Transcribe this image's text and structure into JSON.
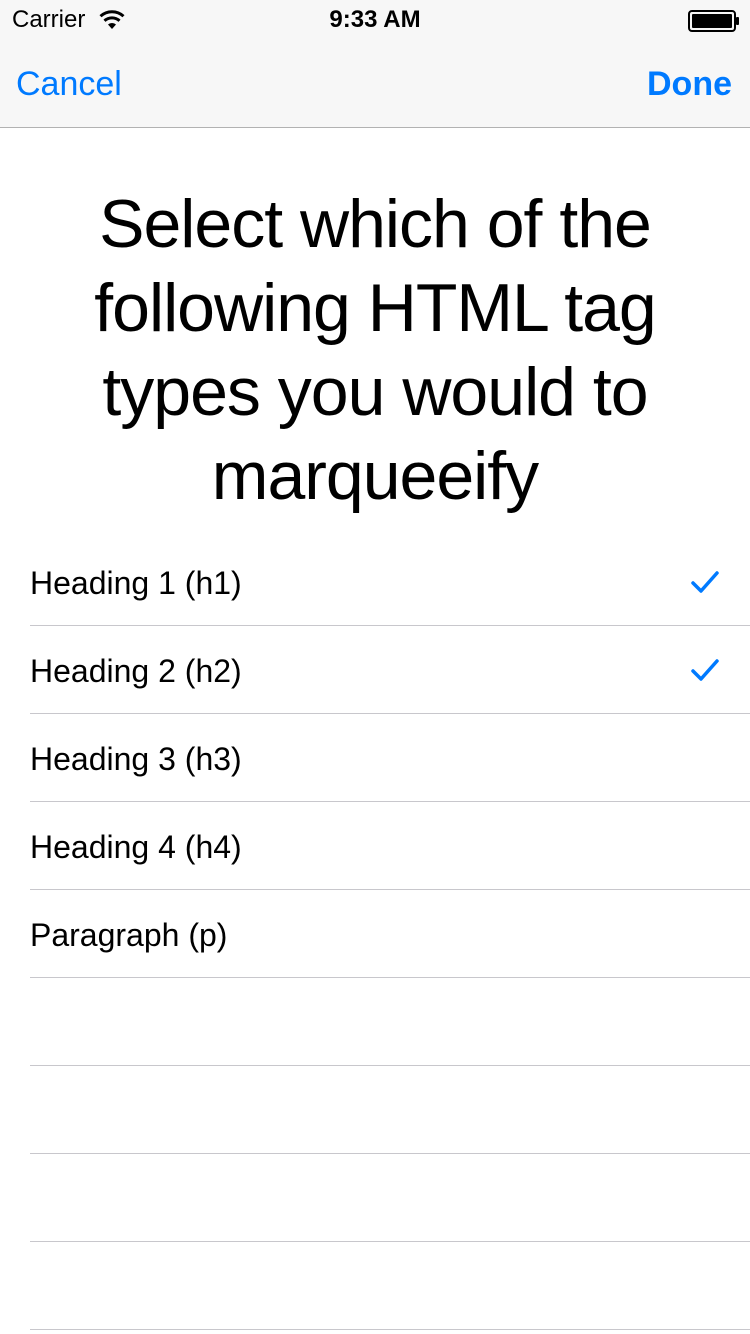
{
  "status_bar": {
    "carrier": "Carrier",
    "time": "9:33 AM",
    "icons": [
      "wifi-icon",
      "battery-icon"
    ]
  },
  "nav": {
    "cancel_label": "Cancel",
    "done_label": "Done"
  },
  "prompt": "Select which of the following HTML tag types you would to marqueeify",
  "options": [
    {
      "label": "Heading 1 (h1)",
      "checked": true
    },
    {
      "label": "Heading 2 (h2)",
      "checked": true
    },
    {
      "label": "Heading 3 (h3)",
      "checked": false
    },
    {
      "label": "Heading 4 (h4)",
      "checked": false
    },
    {
      "label": "Paragraph (p)",
      "checked": false
    }
  ],
  "colors": {
    "accent": "#007aff",
    "nav_background": "#f7f7f7",
    "separator": "#c8c7cc"
  }
}
